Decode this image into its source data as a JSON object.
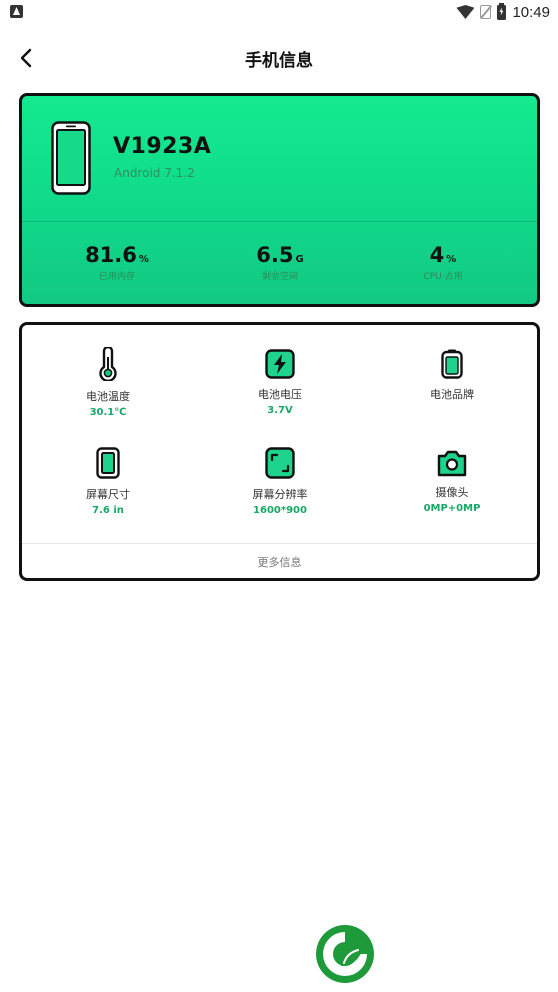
{
  "status_bar": {
    "time": "10:49",
    "icons": [
      "notification-a-icon",
      "wifi-icon",
      "no-sim-icon",
      "battery-charging-icon"
    ]
  },
  "header": {
    "title": "手机信息",
    "back_icon": "back-arrow-icon"
  },
  "device": {
    "model": "V1923A",
    "os": "Android 7.1.2",
    "stats": [
      {
        "value": "81.6",
        "unit": "%",
        "label": "已用内存"
      },
      {
        "value": "6.5",
        "unit": "G",
        "label": "剩余空间"
      },
      {
        "value": "4",
        "unit": "%",
        "label": "CPU 占用"
      }
    ]
  },
  "info": {
    "items": [
      {
        "icon": "thermometer-icon",
        "label": "电池温度",
        "value": "30.1℃"
      },
      {
        "icon": "battery-voltage-icon",
        "label": "电池电压",
        "value": "3.7V"
      },
      {
        "icon": "battery-brand-icon",
        "label": "电池品牌",
        "value": ""
      },
      {
        "icon": "screen-size-icon",
        "label": "屏幕尺寸",
        "value": "7.6 in"
      },
      {
        "icon": "screen-resolution-icon",
        "label": "屏幕分辨率",
        "value": "1600*900"
      },
      {
        "icon": "camera-icon",
        "label": "摄像头",
        "value": "0MP+0MP"
      }
    ],
    "more_label": "更多信息"
  },
  "colors": {
    "accent": "#17a867",
    "card_green": "#14ea8f",
    "logo_green": "#1e9a3a"
  }
}
